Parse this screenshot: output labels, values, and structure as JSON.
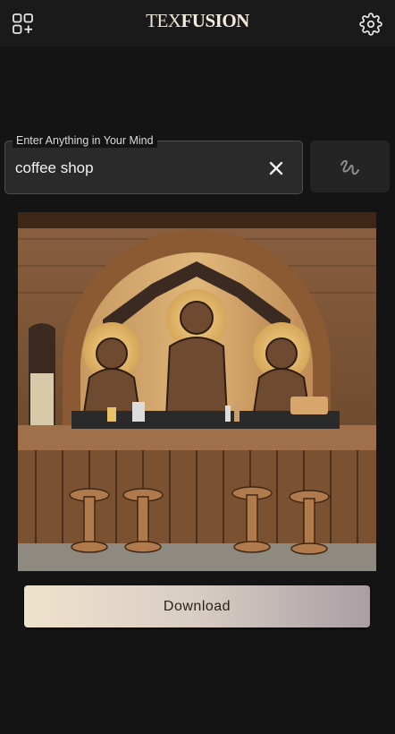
{
  "header": {
    "brand_part_a": "TEX",
    "brand_part_b": "FUSION",
    "apps_icon": "grid-add-icon",
    "settings_icon": "gear-icon"
  },
  "prompt": {
    "label": "Enter Anything in Your Mind",
    "value": "coffee shop",
    "clear_icon": "close-icon"
  },
  "generate": {
    "icon": "scribble-icon"
  },
  "result": {
    "image": "generated-image"
  },
  "actions": {
    "download_label": "Download"
  },
  "colors": {
    "background": "#141414",
    "field_bg": "#2a2a2a",
    "button_gradient_start": "#efe2cc",
    "button_gradient_end": "#a99ea3"
  }
}
